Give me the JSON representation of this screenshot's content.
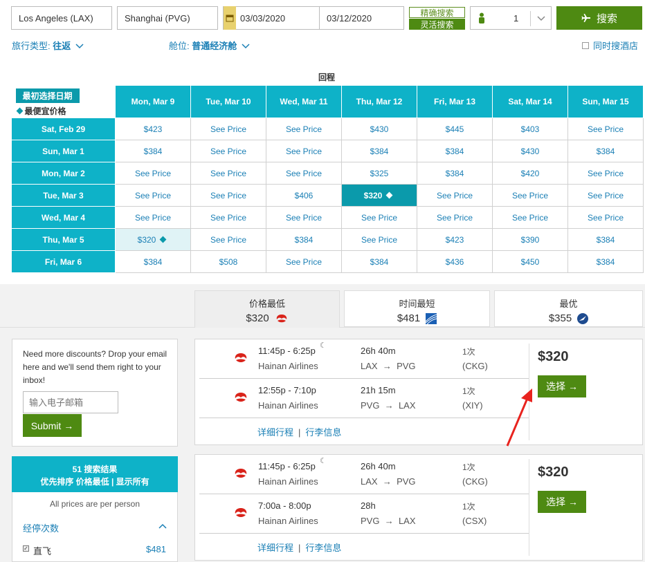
{
  "search": {
    "origin": "Los Angeles (LAX)",
    "destination": "Shanghai (PVG)",
    "depart_date": "03/03/2020",
    "return_date": "03/12/2020",
    "mode_exact": "精确搜索",
    "mode_flex": "灵活搜索",
    "passengers": "1",
    "search_label": "搜索"
  },
  "options": {
    "trip_type_label": "旅行类型:",
    "trip_type_value": "往返",
    "cabin_label": "舱位:",
    "cabin_value": "普通经济舱",
    "hotel_label": "同时搜酒店"
  },
  "matrix": {
    "return_label": "回程",
    "legend_selected": "最初选择日期",
    "legend_cheapest": "最便宜价格",
    "columns": [
      "Mon, Mar 9",
      "Tue, Mar 10",
      "Wed, Mar 11",
      "Thu, Mar 12",
      "Fri, Mar 13",
      "Sat, Mar 14",
      "Sun, Mar 15"
    ],
    "rows": [
      {
        "label": "Sat, Feb 29",
        "cells": [
          "$423",
          "See Price",
          "See Price",
          "$430",
          "$445",
          "$403",
          "See Price"
        ]
      },
      {
        "label": "Sun, Mar 1",
        "cells": [
          "$384",
          "See Price",
          "See Price",
          "$384",
          "$384",
          "$430",
          "$384"
        ]
      },
      {
        "label": "Mon, Mar 2",
        "cells": [
          "See Price",
          "See Price",
          "See Price",
          "$325",
          "$384",
          "$420",
          "See Price"
        ]
      },
      {
        "label": "Tue, Mar 3",
        "cells": [
          "See Price",
          "See Price",
          "$406",
          "$320",
          "See Price",
          "See Price",
          "See Price"
        ]
      },
      {
        "label": "Wed, Mar 4",
        "cells": [
          "See Price",
          "See Price",
          "See Price",
          "See Price",
          "See Price",
          "See Price",
          "See Price"
        ]
      },
      {
        "label": "Thu, Mar 5",
        "cells": [
          "$320",
          "See Price",
          "$384",
          "See Price",
          "$423",
          "$390",
          "$384"
        ]
      },
      {
        "label": "Fri, Mar 6",
        "cells": [
          "$384",
          "$508",
          "See Price",
          "$384",
          "$436",
          "$450",
          "$384"
        ]
      }
    ]
  },
  "sort_tabs": [
    {
      "title": "价格最低",
      "price": "$320"
    },
    {
      "title": "时间最短",
      "price": "$481"
    },
    {
      "title": "最优",
      "price": "$355"
    }
  ],
  "promo": {
    "text": "Need more discounts? Drop your email here and we'll send them right to your inbox!",
    "placeholder": "输入电子邮箱",
    "submit": "Submit"
  },
  "results_summary": {
    "line1": "51 搜索结果",
    "line2": "优先排序 价格最低 | 显示所有",
    "note": "All prices are per person",
    "filter_title": "经停次数",
    "filter_nonstop": "直飞",
    "filter_nonstop_price": "$481"
  },
  "flights": [
    {
      "price": "$320",
      "select": "选择",
      "links": [
        "详细行程",
        "行李信息"
      ],
      "legs": [
        {
          "time": "11:45p - 6:25p",
          "airline": "Hainan Airlines",
          "duration": "26h 40m",
          "from": "LAX",
          "to": "PVG",
          "stops": "1次",
          "via": "(CKG)"
        },
        {
          "time": "12:55p - 7:10p",
          "airline": "Hainan Airlines",
          "duration": "21h 15m",
          "from": "PVG",
          "to": "LAX",
          "stops": "1次",
          "via": "(XIY)"
        }
      ]
    },
    {
      "price": "$320",
      "select": "选择",
      "links": [
        "详细行程",
        "行李信息"
      ],
      "legs": [
        {
          "time": "11:45p - 6:25p",
          "airline": "Hainan Airlines",
          "duration": "26h 40m",
          "from": "LAX",
          "to": "PVG",
          "stops": "1次",
          "via": "(CKG)"
        },
        {
          "time": "7:00a - 8:00p",
          "airline": "Hainan Airlines",
          "duration": "28h",
          "from": "PVG",
          "to": "LAX",
          "stops": "1次",
          "via": "(CSX)"
        }
      ]
    }
  ],
  "colors": {
    "accent": "#0eb2c8",
    "brand_green": "#4e8a12",
    "link": "#1a7fb5",
    "annotation": "#e8231e"
  }
}
